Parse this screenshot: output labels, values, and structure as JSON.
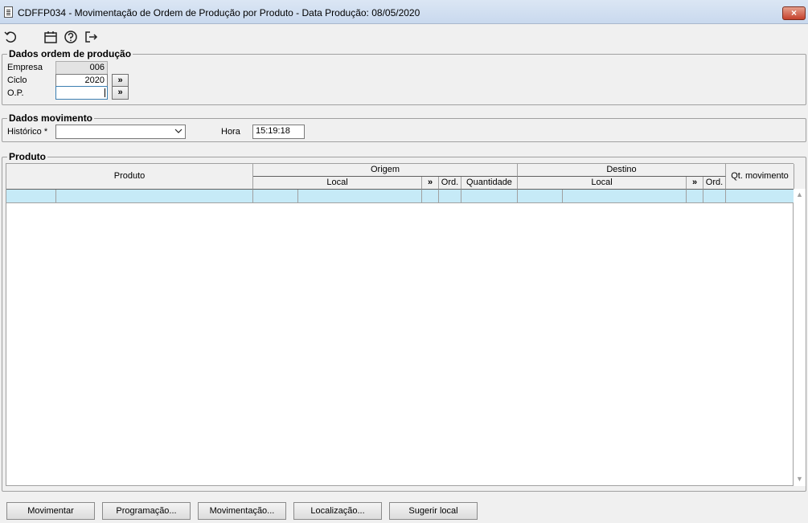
{
  "window": {
    "title": "CDFFP034 - Movimentação de Ordem de Produção por Produto - Data Produção: 08/05/2020",
    "close_label": "×"
  },
  "toolbar": {
    "icons": [
      "undo-icon",
      "calendar-icon",
      "help-icon",
      "exit-icon"
    ]
  },
  "dados_ordem": {
    "title": "Dados ordem de produção",
    "empresa_label": "Empresa",
    "empresa_value": "006",
    "ciclo_label": "Ciclo",
    "ciclo_value": "2020",
    "op_label": "O.P.",
    "op_value": "",
    "lookup_label": "»"
  },
  "dados_movimento": {
    "title": "Dados movimento",
    "historico_label": "Histórico *",
    "historico_value": "",
    "hora_label": "Hora",
    "hora_value": "15:19:18"
  },
  "produto": {
    "title": "Produto",
    "headers": {
      "produto": "Produto",
      "origem": "Origem",
      "destino": "Destino",
      "qt_movimento": "Qt. movimento",
      "local": "Local",
      "arrow": "»",
      "ord": "Ord.",
      "quantidade": "Quantidade"
    }
  },
  "buttons": {
    "movimentar": "Movimentar",
    "programacao": "Programação...",
    "movimentacao": "Movimentação...",
    "localizacao": "Localização...",
    "sugerir_local": "Sugerir local"
  }
}
